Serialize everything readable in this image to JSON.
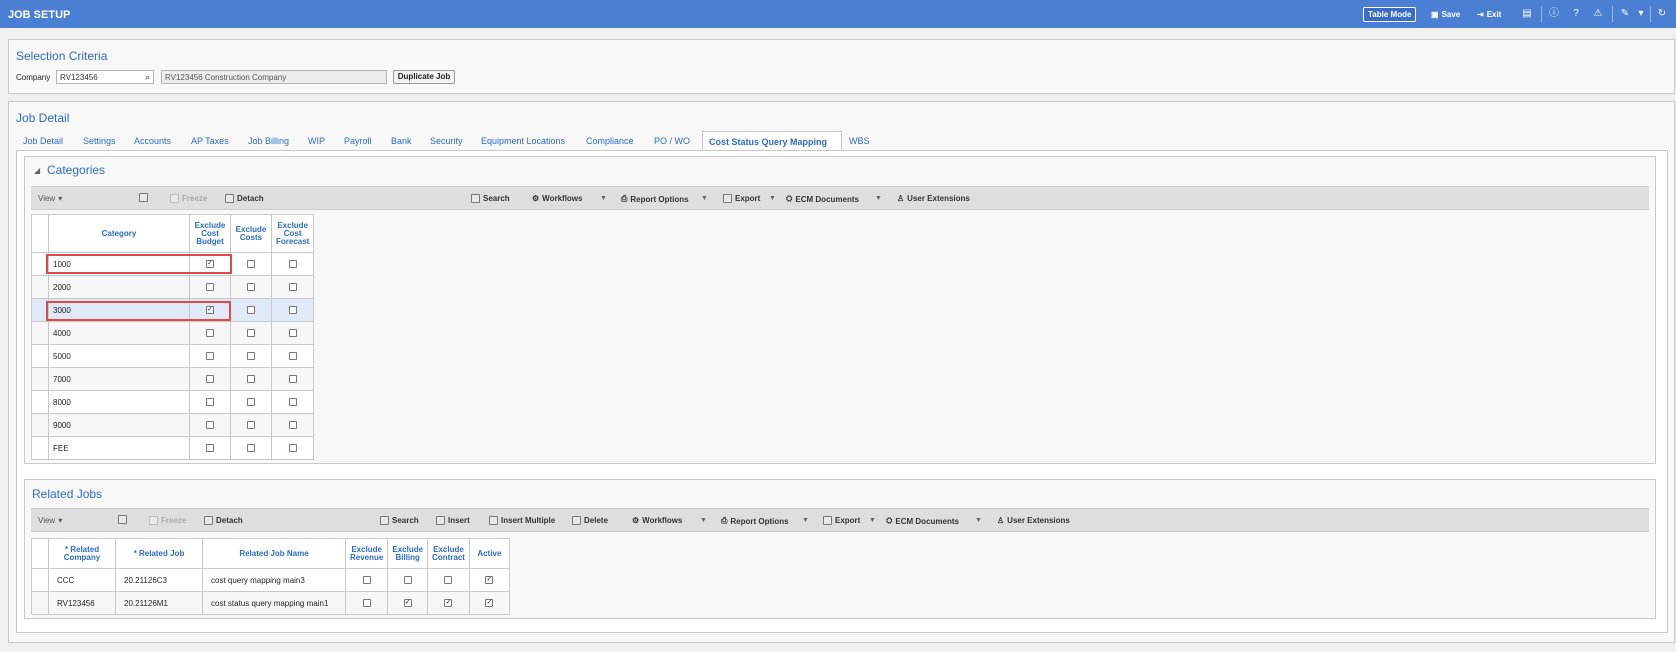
{
  "app": {
    "title": "JOB SETUP",
    "table_mode_label": "Table Mode",
    "save_label": "Save",
    "exit_label": "Exit"
  },
  "selection": {
    "title": "Selection Criteria",
    "company_label": "Company",
    "company_value": "RV123456",
    "company_name_value": "RV123456  Construction Company",
    "duplicate_job_label": "Duplicate Job"
  },
  "job_detail": {
    "title": "Job Detail",
    "tabs": [
      "Job Detail",
      "Settings",
      "Accounts",
      "AP Taxes",
      "Job Billing",
      "WIP",
      "Payroll",
      "Bank",
      "Security",
      "Equipment Locations",
      "Compliance",
      "PO / WO",
      "Cost Status Query Mapping",
      "WBS"
    ],
    "active_tab": "Cost Status Query Mapping"
  },
  "categories": {
    "title": "Categories",
    "toolbar": {
      "view": "View",
      "freeze": "Freeze",
      "detach": "Detach",
      "search": "Search",
      "workflows": "Workflows",
      "report_options": "Report Options",
      "export": "Export",
      "ecm_documents": "ECM Documents",
      "user_extensions": "User Extensions"
    },
    "columns": {
      "category": "Category",
      "exclude_cost_budget_1": "Exclude",
      "exclude_cost_budget_2": "Cost",
      "exclude_cost_budget_3": "Budget",
      "exclude_costs_1": "Exclude",
      "exclude_costs_2": "Costs",
      "exclude_cost_forecast_1": "Exclude",
      "exclude_cost_forecast_2": "Cost",
      "exclude_cost_forecast_3": "Forecast"
    },
    "rows": [
      {
        "category": "1000",
        "budget": true,
        "costs": false,
        "forecast": false
      },
      {
        "category": "2000",
        "budget": false,
        "costs": false,
        "forecast": false
      },
      {
        "category": "3000",
        "budget": true,
        "costs": false,
        "forecast": false
      },
      {
        "category": "4000",
        "budget": false,
        "costs": false,
        "forecast": false
      },
      {
        "category": "5000",
        "budget": false,
        "costs": false,
        "forecast": false
      },
      {
        "category": "7000",
        "budget": false,
        "costs": false,
        "forecast": false
      },
      {
        "category": "8000",
        "budget": false,
        "costs": false,
        "forecast": false
      },
      {
        "category": "9000",
        "budget": false,
        "costs": false,
        "forecast": false
      },
      {
        "category": "FEE",
        "budget": false,
        "costs": false,
        "forecast": false
      }
    ]
  },
  "related_jobs": {
    "title": "Related Jobs",
    "toolbar": {
      "view": "View",
      "freeze": "Freeze",
      "detach": "Detach",
      "search": "Search",
      "insert": "Insert",
      "insert_multiple": "Insert Multiple",
      "delete": "Delete",
      "workflows": "Workflows",
      "report_options": "Report Options",
      "export": "Export",
      "ecm_documents": "ECM Documents",
      "user_extensions": "User Extensions"
    },
    "columns": {
      "related_company_1": "* Related",
      "related_company_2": "Company",
      "related_job": "* Related Job",
      "related_job_name": "Related Job Name",
      "exclude_revenue_1": "Exclude",
      "exclude_revenue_2": "Revenue",
      "exclude_billing_1": "Exclude",
      "exclude_billing_2": "Billing",
      "exclude_contract_1": "Exclude",
      "exclude_contract_2": "Contract",
      "active": "Active"
    },
    "rows": [
      {
        "company": "CCC",
        "job": "20.21126C3",
        "name": "cost query mapping main3",
        "revenue": false,
        "billing": false,
        "contract": false,
        "active": true
      },
      {
        "company": "RV123456",
        "job": "20.21126M1",
        "name": "cost status query mapping main1",
        "revenue": false,
        "billing": true,
        "contract": true,
        "active": true
      }
    ]
  }
}
